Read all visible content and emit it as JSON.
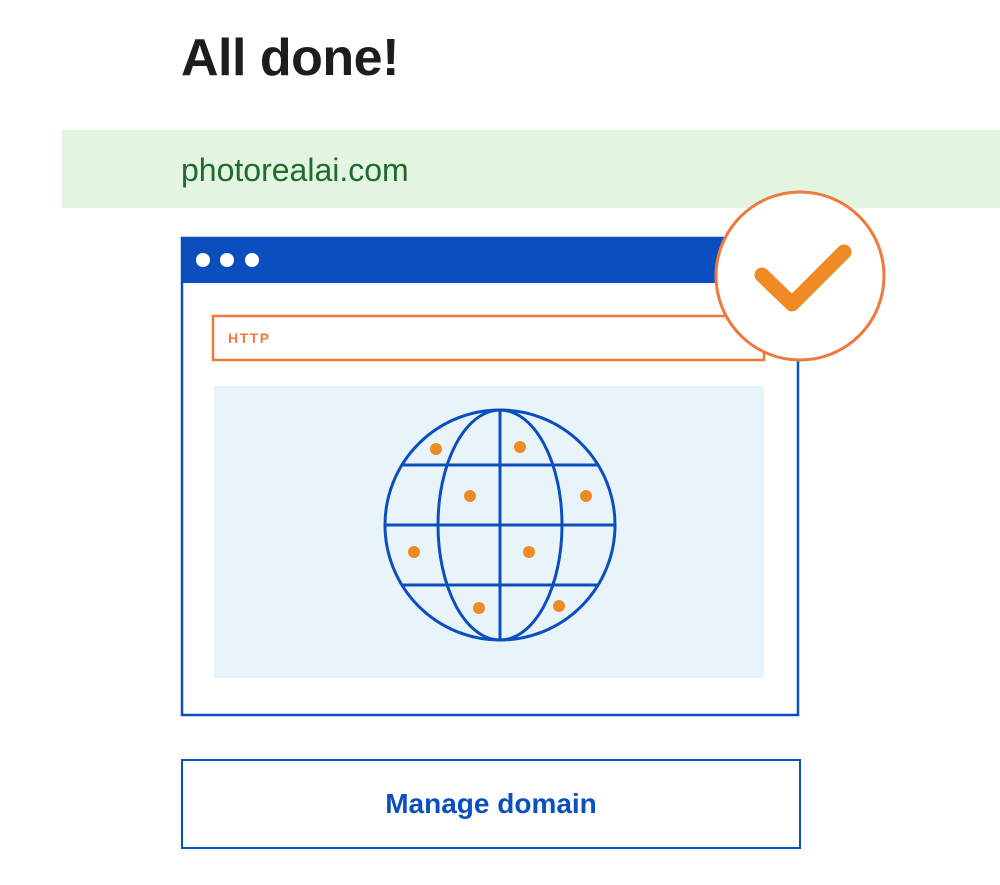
{
  "header": {
    "title": "All done!"
  },
  "domain": {
    "name": "photorealai.com"
  },
  "illustration": {
    "address_bar_label": "HTTP"
  },
  "actions": {
    "manage_label": "Manage domain"
  },
  "colors": {
    "brand_blue": "#0b4fbf",
    "accent_orange": "#f08a24",
    "success_bg": "#e3f4e0",
    "success_text": "#1e6b2e",
    "content_bg": "#e9f4fa"
  }
}
